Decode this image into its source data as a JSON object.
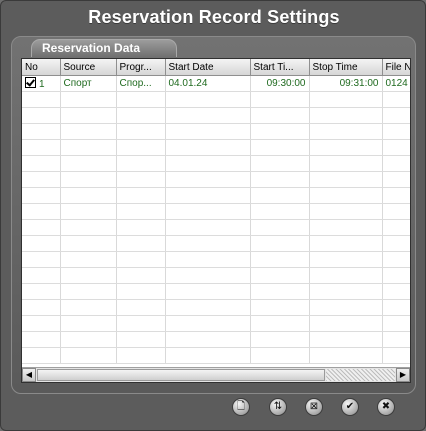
{
  "window": {
    "title": "Reservation Record Settings"
  },
  "tab": {
    "label": "Reservation Data"
  },
  "table": {
    "columns": [
      "No",
      "Source",
      "Progr...",
      "Start Date",
      "Start Ti...",
      "Stop Time",
      "File N"
    ],
    "rows": [
      {
        "checked": true,
        "no": "1",
        "source": "Спорт",
        "program": "Спор...",
        "start_date": "04.01.24",
        "start_time": "09:30:00",
        "stop_time": "09:31:00",
        "file": "0124"
      }
    ]
  },
  "scrollbar": {
    "left_arrow": "◀",
    "right_arrow": "▶",
    "position_percent": 0
  },
  "toolbar": {
    "buttons": [
      {
        "name": "new-icon",
        "glyph": "🗋"
      },
      {
        "name": "edit-icon",
        "glyph": "⇅"
      },
      {
        "name": "delete-icon",
        "glyph": "⊠"
      },
      {
        "name": "ok-icon",
        "glyph": "✔"
      },
      {
        "name": "close-icon",
        "glyph": "✖"
      }
    ]
  }
}
